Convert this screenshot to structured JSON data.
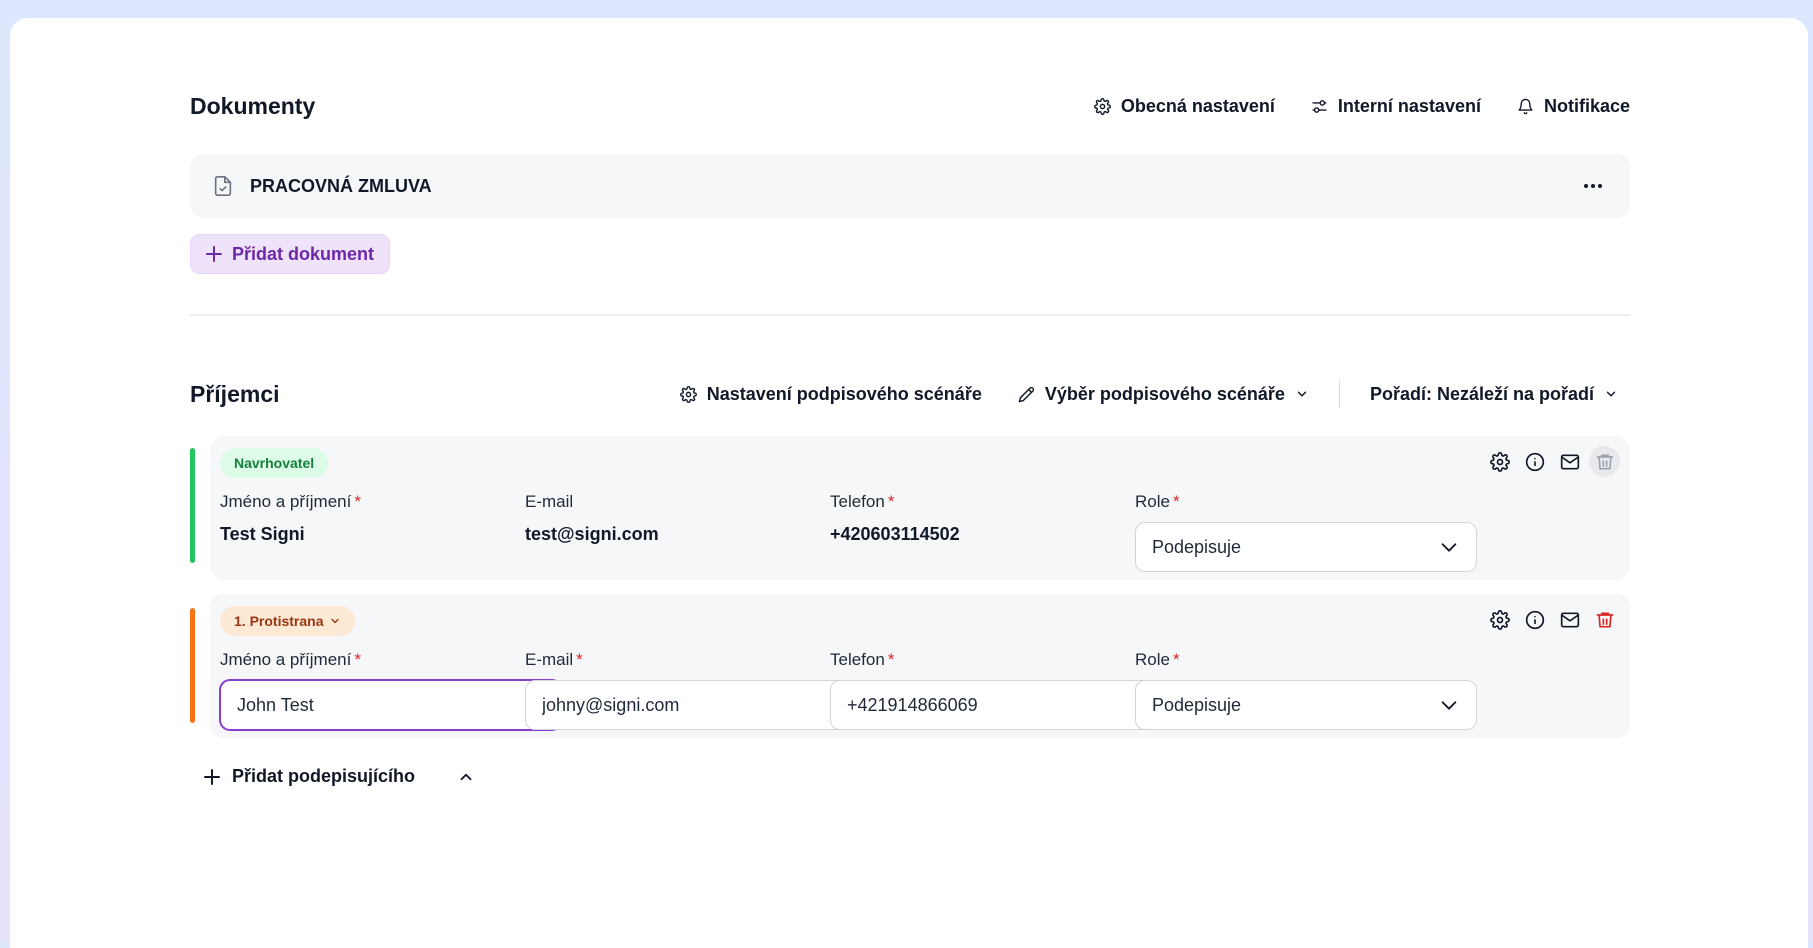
{
  "documents": {
    "title": "Dokumenty",
    "actions": {
      "general_settings": "Obecná nastavení",
      "internal_settings": "Interní nastavení",
      "notifications": "Notifikace"
    },
    "items": [
      {
        "name": "PRACOVNÁ ZMLUVA",
        "icon": "document-check-icon"
      }
    ],
    "add_label": "Přidat dokument"
  },
  "recipients": {
    "title": "Příjemci",
    "actions": {
      "scenario_settings": "Nastavení podpisového scénáře",
      "scenario_select": "Výběr podpisového scénáře",
      "order": "Pořadí: Nezáleží na pořadí"
    },
    "labels": {
      "name": "Jméno a příjmení",
      "email": "E-mail",
      "phone": "Telefon",
      "role": "Role",
      "required_mark": "*"
    },
    "list": [
      {
        "badge": "Navrhovatel",
        "accent_color": "#22c55e",
        "name": "Test Signi",
        "email": "test@signi.com",
        "phone": "+420603114502",
        "role": "Podepisuje"
      },
      {
        "badge": "1. Protistrana",
        "accent_color": "#f97316",
        "name": "John Test",
        "email": "johny@signi.com",
        "phone": "+421914866069",
        "role": "Podepisuje"
      }
    ],
    "add_signer_label": "Přidat podepisujícího"
  },
  "colors": {
    "brand_purple": "#6d28a6",
    "danger": "#dc2626",
    "proposer_accent": "#22c55e",
    "counterparty_accent": "#f97316"
  }
}
